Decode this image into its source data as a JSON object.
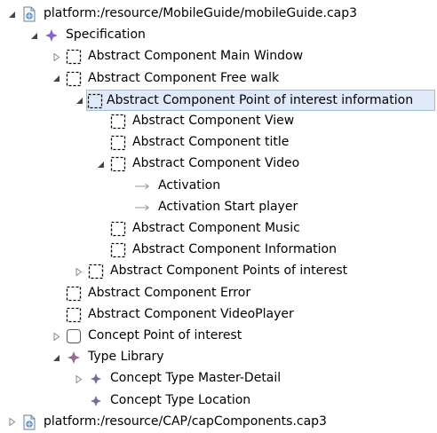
{
  "tree": {
    "nodes": [
      {
        "label": "platform:/resource/MobileGuide/mobileGuide.cap3",
        "icon": "resource-file-icon",
        "twisty": "expanded"
      },
      {
        "label": "Specification",
        "icon": "specification-icon",
        "twisty": "expanded"
      },
      {
        "label": "Abstract Component Main Window",
        "icon": "abstract-component-icon",
        "twisty": "collapsed"
      },
      {
        "label": "Abstract Component Free walk",
        "icon": "abstract-component-icon",
        "twisty": "expanded"
      },
      {
        "label": "Abstract Component Point of interest information",
        "icon": "abstract-component-icon",
        "twisty": "expanded",
        "selected": true
      },
      {
        "label": "Abstract Component View",
        "icon": "abstract-component-icon",
        "twisty": "none"
      },
      {
        "label": "Abstract Component title",
        "icon": "abstract-component-icon",
        "twisty": "none"
      },
      {
        "label": "Abstract Component Video",
        "icon": "abstract-component-icon",
        "twisty": "expanded"
      },
      {
        "label": "Activation",
        "icon": "activation-arrow-icon",
        "twisty": "none"
      },
      {
        "label": "Activation Start player",
        "icon": "activation-arrow-icon",
        "twisty": "none"
      },
      {
        "label": "Abstract Component Music",
        "icon": "abstract-component-icon",
        "twisty": "none"
      },
      {
        "label": "Abstract Component Information",
        "icon": "abstract-component-icon",
        "twisty": "none"
      },
      {
        "label": "Abstract Component Points of interest",
        "icon": "abstract-component-icon",
        "twisty": "collapsed"
      },
      {
        "label": "Abstract Component Error",
        "icon": "abstract-component-icon",
        "twisty": "none"
      },
      {
        "label": "Abstract Component VideoPlayer",
        "icon": "abstract-component-icon",
        "twisty": "none"
      },
      {
        "label": "Concept Point of interest",
        "icon": "concept-icon",
        "twisty": "collapsed"
      },
      {
        "label": "Type Library",
        "icon": "type-library-icon",
        "twisty": "expanded"
      },
      {
        "label": "Concept Type Master-Detail",
        "icon": "concept-type-icon",
        "twisty": "collapsed"
      },
      {
        "label": "Concept Type Location",
        "icon": "concept-type-icon",
        "twisty": "none"
      },
      {
        "label": "platform:/resource/CAP/capComponents.cap3",
        "icon": "resource-file-icon",
        "twisty": "collapsed"
      }
    ]
  },
  "colors": {
    "selection_bg": "#dfe9f7",
    "selection_border": "#9ebfe6",
    "spec_icon": "#8a63c6",
    "type_library_icon": "#9b6a8f",
    "concept_type_icon": "#7d6a9b"
  }
}
